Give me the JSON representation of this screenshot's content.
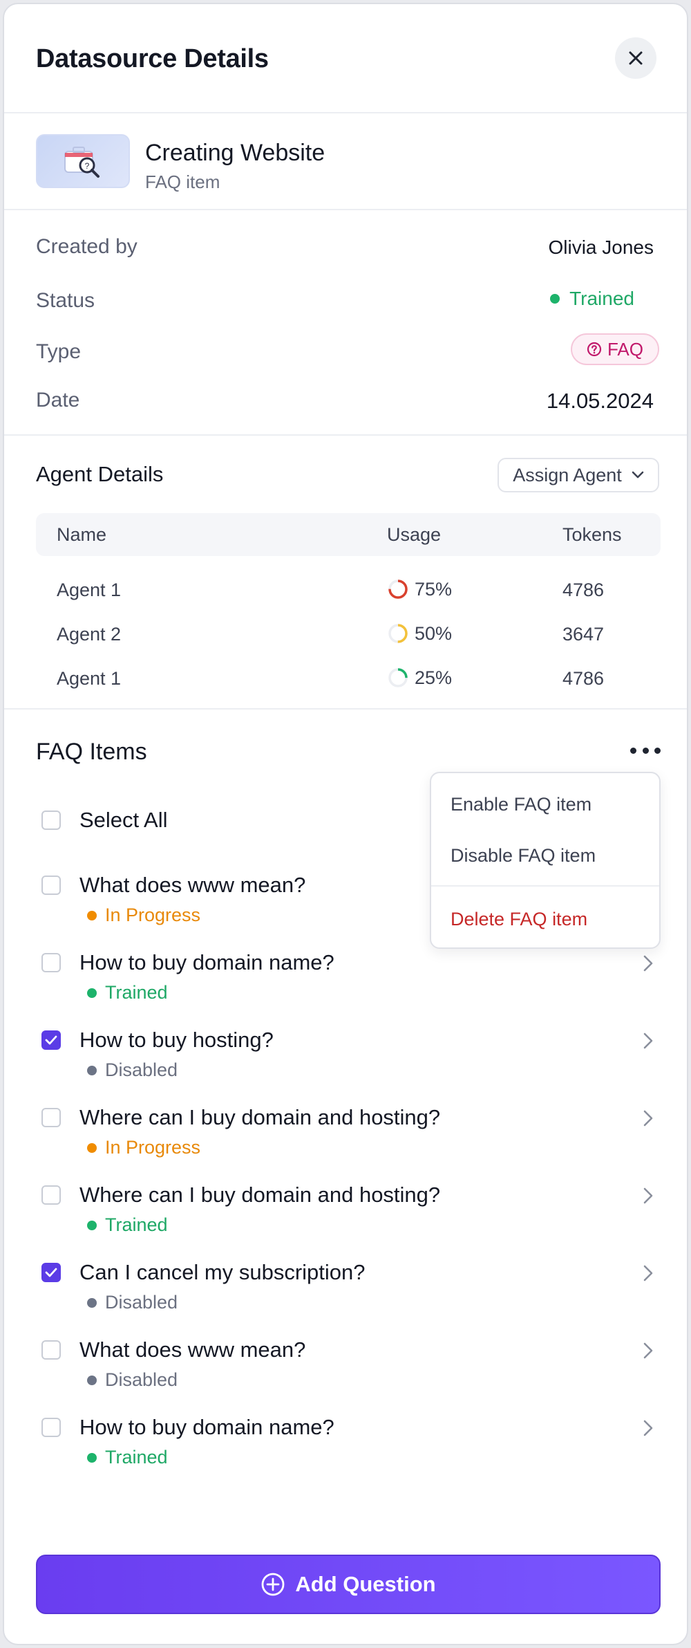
{
  "header": {
    "title": "Datasource Details",
    "close_icon": "close-icon"
  },
  "datasource": {
    "name": "Creating Website",
    "subtitle": "FAQ item",
    "thumb_icon": "briefcase-search-icon"
  },
  "meta": {
    "created_by_label": "Created by",
    "created_by_value": "Olivia Jones",
    "status_label": "Status",
    "status_value": "Trained",
    "type_label": "Type",
    "type_value": "FAQ",
    "date_label": "Date",
    "date_value": "14.05.2024"
  },
  "agents": {
    "title": "Agent Details",
    "assign_label": "Assign Agent",
    "columns": {
      "name": "Name",
      "usage": "Usage",
      "tokens": "Tokens"
    },
    "rows": [
      {
        "name": "Agent 1",
        "usage": "75%",
        "usage_value": 0.75,
        "color": "#d9412e",
        "tokens": "4786"
      },
      {
        "name": "Agent 2",
        "usage": "50%",
        "usage_value": 0.5,
        "color": "#f3c13a",
        "tokens": "3647"
      },
      {
        "name": "Agent 1",
        "usage": "25%",
        "usage_value": 0.25,
        "color": "#1db36b",
        "tokens": "4786"
      }
    ]
  },
  "faq": {
    "title": "FAQ Items",
    "select_all": "Select All",
    "items": [
      {
        "question": "What does www mean?",
        "status": "In Progress",
        "checked": false
      },
      {
        "question": "How to buy domain name?",
        "status": "Trained",
        "checked": false
      },
      {
        "question": "How to buy hosting?",
        "status": "Disabled",
        "checked": true
      },
      {
        "question": "Where can I buy domain and hosting?",
        "status": "In Progress",
        "checked": false
      },
      {
        "question": "Where can I buy domain and hosting?",
        "status": "Trained",
        "checked": false
      },
      {
        "question": "Can I cancel my subscription?",
        "status": "Disabled",
        "checked": true
      },
      {
        "question": "What does www mean?",
        "status": "Disabled",
        "checked": false
      },
      {
        "question": "How to buy domain name?",
        "status": "Trained",
        "checked": false
      }
    ],
    "menu": {
      "enable": "Enable FAQ item",
      "disable": "Disable FAQ item",
      "delete": "Delete FAQ item"
    }
  },
  "footer": {
    "add_label": "Add Question"
  },
  "colors": {
    "accent": "#5b3ce6",
    "trained": "#1fa866",
    "in_progress": "#e8890a",
    "disabled": "#6b7080",
    "danger": "#c62828"
  }
}
